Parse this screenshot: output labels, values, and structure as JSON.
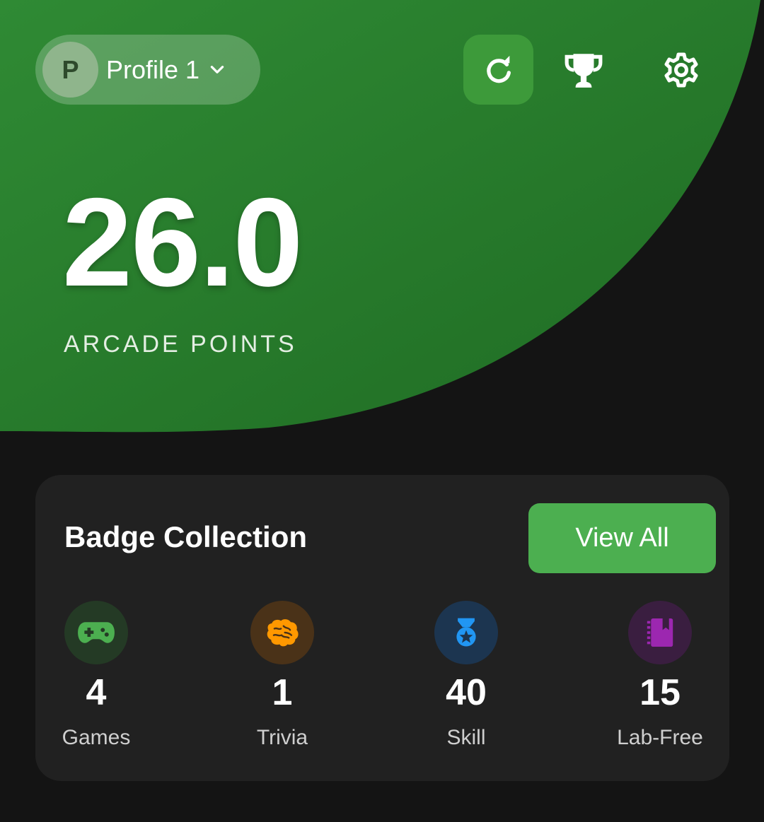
{
  "header": {
    "profile": {
      "avatar_letter": "P",
      "name": "Profile 1"
    },
    "actions": {
      "refresh_icon": "refresh-icon",
      "trophy_icon": "trophy-icon",
      "settings_icon": "gear-icon"
    },
    "accent_color": "#2e7d32"
  },
  "points": {
    "value": "26.0",
    "label": "ARCADE POINTS"
  },
  "badge_collection": {
    "title": "Badge Collection",
    "view_all_label": "View All",
    "categories": [
      {
        "icon": "gamepad-icon",
        "count": "4",
        "label": "Games",
        "color": "#4caf50"
      },
      {
        "icon": "brain-icon",
        "count": "1",
        "label": "Trivia",
        "color": "#ff9800"
      },
      {
        "icon": "medal-icon",
        "count": "40",
        "label": "Skill",
        "color": "#2196f3"
      },
      {
        "icon": "book-icon",
        "count": "15",
        "label": "Lab-Free",
        "color": "#9c27b0"
      }
    ]
  }
}
